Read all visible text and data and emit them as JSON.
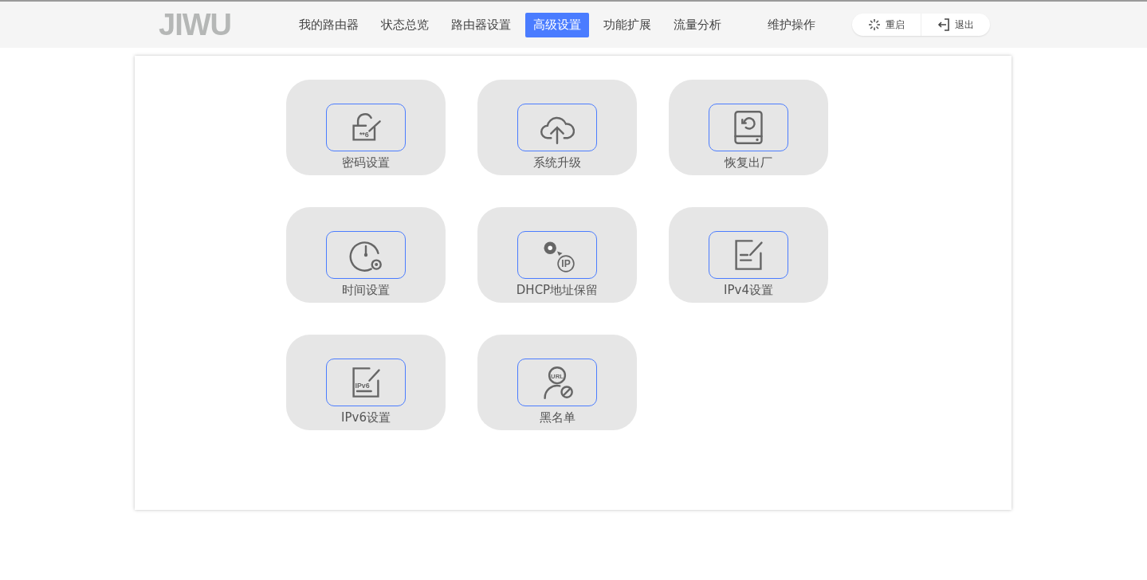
{
  "logo": "JIWU",
  "nav": [
    {
      "label": "我的路由器",
      "selected": false
    },
    {
      "label": "状态总览",
      "selected": false
    },
    {
      "label": "路由器设置",
      "selected": false
    },
    {
      "label": "高级设置",
      "selected": true
    },
    {
      "label": "功能扩展",
      "selected": false
    },
    {
      "label": "流量分析",
      "selected": false
    },
    {
      "label": "维护操作",
      "selected": false
    }
  ],
  "actions": [
    {
      "kind": "restart",
      "label": "重启"
    },
    {
      "kind": "logout",
      "label": "退出"
    }
  ],
  "tiles": [
    {
      "kind": "password",
      "label": "密码设置",
      "icon_text": "**6"
    },
    {
      "kind": "upgrade",
      "label": "系统升级"
    },
    {
      "kind": "reset",
      "label": "恢复出厂"
    },
    {
      "kind": "time",
      "label": "时间设置"
    },
    {
      "kind": "dhcp",
      "label": "DHCP地址保留",
      "icon_text": "IP"
    },
    {
      "kind": "ipv4",
      "label": "IPv4设置"
    },
    {
      "kind": "ipv6",
      "label": "IPv6设置",
      "icon_text": "IPv6"
    },
    {
      "kind": "blacklist",
      "label": "黑名单",
      "icon_text": "URL"
    }
  ]
}
